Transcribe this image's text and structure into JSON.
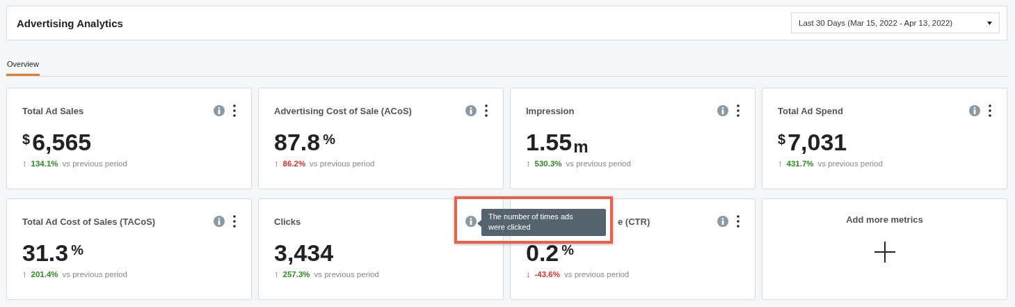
{
  "header": {
    "title": "Advertising Analytics",
    "date_range": "Last 30 Days (Mar 15, 2022 - Apr 13, 2022)"
  },
  "tabs": [
    {
      "label": "Overview",
      "selected": true
    }
  ],
  "cards": [
    {
      "kind": "metric",
      "title": "Total Ad Sales",
      "prefix": "$",
      "value": "6,565",
      "arrow": "↑",
      "good": true,
      "change": "134.1%",
      "comparison": "vs previous period",
      "menu_icon": true
    },
    {
      "kind": "metric",
      "title": "Advertising Cost of Sale (ACoS)",
      "value": "87.8",
      "suffix": "%",
      "arrow": "↑",
      "good": false,
      "change": "86.2%",
      "comparison": "vs previous period",
      "menu_icon": true
    },
    {
      "kind": "metric",
      "title": "Impression",
      "value": "1.55",
      "suffix": "m",
      "arrow": "↑",
      "good": true,
      "change": "530.3%",
      "comparison": "vs previous period",
      "menu_icon": true
    },
    {
      "kind": "metric",
      "title": "Total Ad Spend",
      "prefix": "$",
      "value": "7,031",
      "arrow": "↑",
      "good": true,
      "change": "431.7%",
      "comparison": "vs previous period",
      "menu_icon": true
    },
    {
      "kind": "metric",
      "title": "Total Ad Cost of Sales (TACoS)",
      "value": "31.3",
      "suffix": "%",
      "arrow": "↑",
      "good": true,
      "change": "201.4%",
      "comparison": "vs previous period",
      "menu_icon": true
    },
    {
      "kind": "metric",
      "title": "Clicks",
      "value": "3,434",
      "arrow": "↑",
      "good": true,
      "change": "257.3%",
      "comparison": "vs previous period",
      "menu_icon": false
    },
    {
      "kind": "metric",
      "title": "e (CTR)",
      "title_covered": true,
      "value": "0.2",
      "suffix": "%",
      "arrow": "↓",
      "good": false,
      "change": "-43.6%",
      "comparison": "vs previous period",
      "menu_icon": true
    },
    {
      "kind": "add",
      "title": "Add more metrics"
    }
  ],
  "tooltip": {
    "text": "The number of times ads were clicked",
    "highlighted": true
  }
}
